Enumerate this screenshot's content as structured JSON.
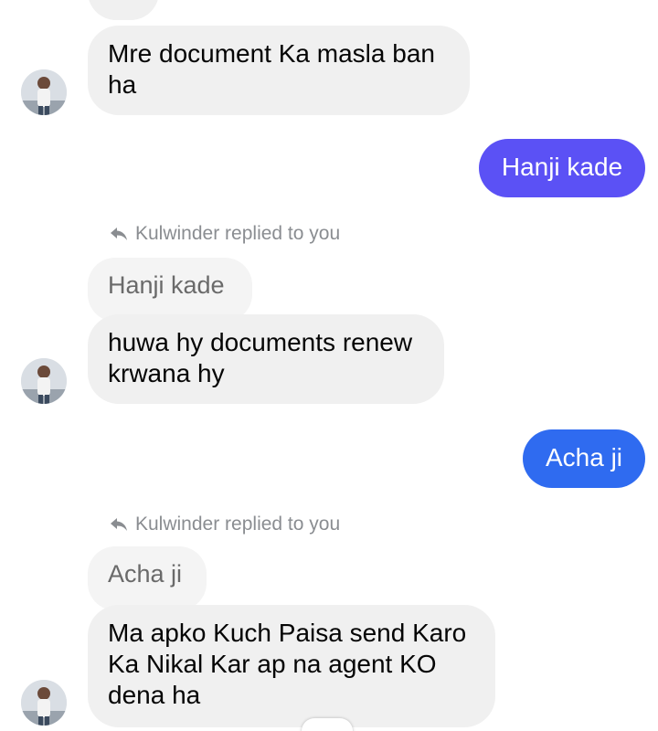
{
  "colors": {
    "outgoing_primary": "#5b51f5",
    "outgoing_secondary": "#2f6bf0",
    "incoming_bg": "#f0f0f0",
    "meta_text": "#8a8d91"
  },
  "messages": {
    "m1": {
      "text": "Mre document Ka masla ban\nha"
    },
    "m2": {
      "text": "Hanji kade"
    },
    "reply1": {
      "icon": "reply-arrow-icon",
      "note": "Kulwinder replied to you",
      "quoted": "Hanji kade"
    },
    "m3": {
      "text": "huwa hy documents renew\nkrwana hy"
    },
    "m4": {
      "text": "Acha ji"
    },
    "reply2": {
      "icon": "reply-arrow-icon",
      "note": "Kulwinder replied to you",
      "quoted": "Acha ji"
    },
    "m5": {
      "text": "Ma apko Kuch Paisa send Karo\nKa Nikal Kar ap na agent KO\ndena ha"
    }
  },
  "avatar": {
    "icon": "contact-avatar"
  }
}
